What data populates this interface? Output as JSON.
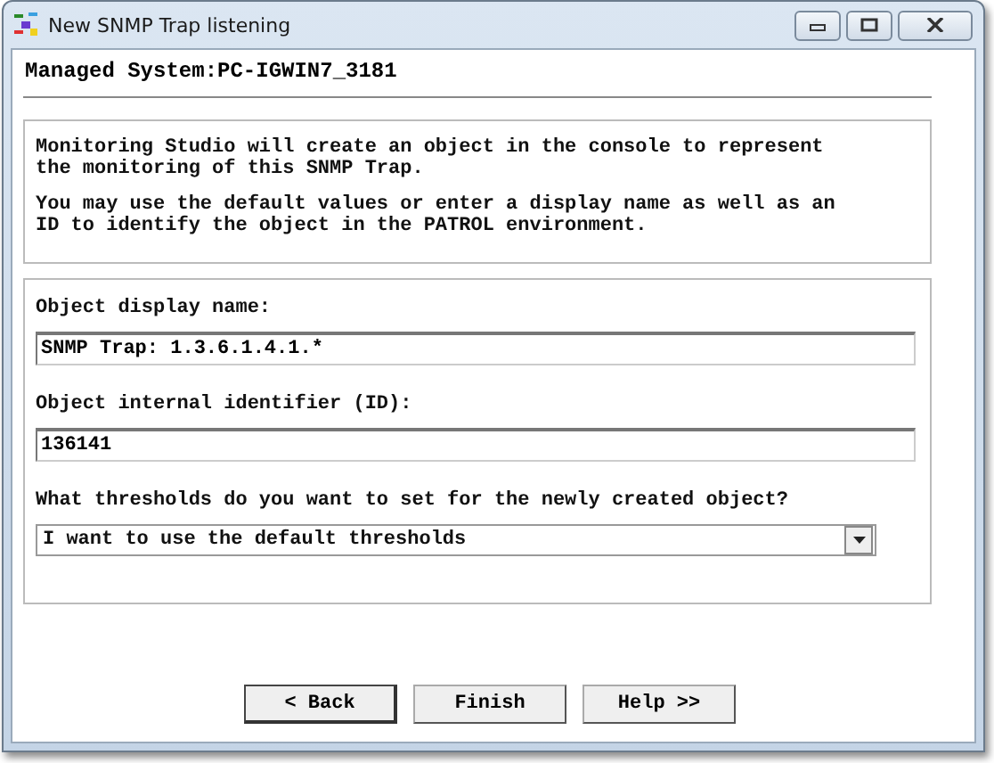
{
  "window": {
    "title": "New SNMP Trap listening"
  },
  "header": "Managed System:PC-IGWIN7_3181",
  "intro": [
    "Monitoring Studio will create an object in the console to represent\nthe monitoring of this SNMP Trap.",
    "You may use the default values or enter a display name as well as an\nID to identify the object in the PATROL environment."
  ],
  "fields": [
    {
      "kind": "text",
      "label": "Object display name:",
      "value": "SNMP Trap: 1.3.6.1.4.1.*"
    },
    {
      "kind": "text",
      "label": "Object internal identifier (ID):",
      "value": "136141"
    },
    {
      "kind": "dropdown",
      "label": "What thresholds do you want to set for the newly created object?",
      "value": "I want to use the default thresholds"
    }
  ],
  "buttons": [
    "< Back",
    "Finish",
    "Help >>"
  ]
}
